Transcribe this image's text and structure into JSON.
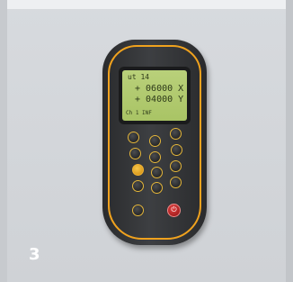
{
  "caption": "3",
  "device": {
    "screen_lines": [
      "ut 14",
      "+ 06000 X",
      "+ 04000 Y",
      "Ch 1    INF"
    ],
    "accent_color": "#f0a21e",
    "screen_color": "#b9d07a",
    "power_color": "#d83232"
  }
}
